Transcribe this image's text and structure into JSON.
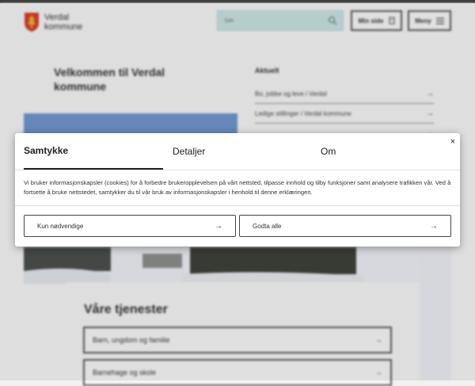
{
  "header": {
    "logo_line1": "Verdal",
    "logo_line2": "kommune",
    "search_placeholder": "Søk",
    "min_side_label": "Min side",
    "meny_label": "Meny"
  },
  "main": {
    "welcome_title": "Velkommen til Verdal kommune",
    "aktuelt_title": "Aktuelt",
    "news_items": [
      "Bo, jobbe og leve i Verdal",
      "Ledige stillinger i Verdal kommune",
      ""
    ],
    "services_title": "Våre tjenester",
    "services": [
      "Barn, ungdom og familie",
      "Barnehage og skole"
    ]
  },
  "cookie_dialog": {
    "tabs": [
      "Samtykke",
      "Detaljer",
      "Om"
    ],
    "close_symbol": "×",
    "description": "Vi bruker informasjonskapsler (cookies) for å forbedre brukeropplevelsen på vårt nettsted, tilpasse innhold og tilby funksjoner samt analysere trafikken vår. Ved å fortsette å bruke nettstedet, samtykker du til vår bruk av informasjonskapsler i henhold til denne erklæringen.",
    "btn_necessary": "Kun nødvendige",
    "btn_accept": "Godta alle",
    "arrow": "→"
  },
  "colors": {
    "hero_blue": "#6e93c9",
    "search_bg": "#c6dfe0",
    "crest_red": "#d23b2e",
    "crest_gold": "#e9b227"
  }
}
